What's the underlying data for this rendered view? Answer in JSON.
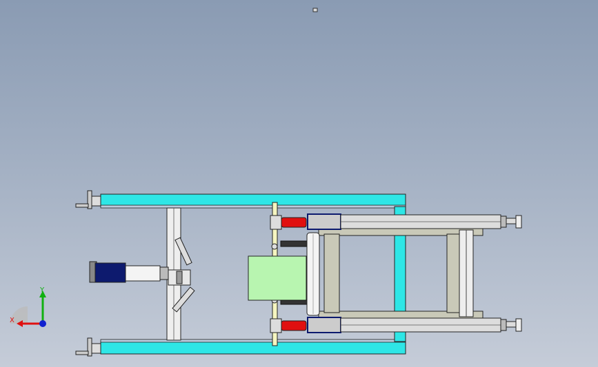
{
  "viewport": {
    "background_top": "#8a9bb3",
    "background_bottom": "#c5ccd8"
  },
  "triad": {
    "x_label": "X",
    "y_label": "Y",
    "x_color": "#e01010",
    "y_color": "#10b010",
    "z_color": "#1020d0"
  },
  "model": {
    "frame_color": "#2ee6e6",
    "cylinder_color": "#e01010",
    "plate_color": "#b8f5b0",
    "motor_color": "#0d1a6e",
    "post_color": "#f5f5c0"
  }
}
